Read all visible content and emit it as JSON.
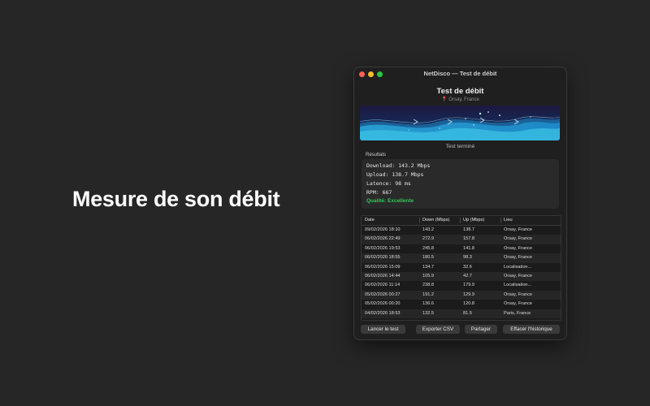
{
  "headline": "Mesure de son débit",
  "window": {
    "title": "NetDisco — Test de débit",
    "heading": "Test de débit",
    "location_pin": "📍",
    "location": "Orsay, France",
    "status": "Test terminé"
  },
  "results": {
    "label": "Résultats",
    "download": "Download: 143.2 Mbps",
    "upload": "Upload: 138.7 Mbps",
    "latency": "Latence: 98 ms",
    "rpm": "RPM: 667",
    "quality": "Qualité: Excellente"
  },
  "table": {
    "headers": [
      "Date",
      "Down (Mbps)",
      "Up (Mbps)",
      "Lieu"
    ],
    "rows": [
      [
        "09/02/2026 18:10",
        "143.2",
        "138.7",
        "Orsay, France"
      ],
      [
        "06/02/2026 22:49",
        "272.9",
        "157.8",
        "Orsay, France"
      ],
      [
        "06/02/2026 19:53",
        "245.8",
        "141.8",
        "Orsay, France"
      ],
      [
        "06/02/2026 18:55",
        "180.5",
        "98.3",
        "Orsay, France"
      ],
      [
        "06/02/2026 15:09",
        "134.7",
        "32.6",
        "Localisation..."
      ],
      [
        "06/02/2026 14:44",
        "105.9",
        "42.7",
        "Orsay, France"
      ],
      [
        "06/02/2026 11:14",
        "238.8",
        "179.9",
        "Localisation..."
      ],
      [
        "05/02/2026 00:27",
        "191.2",
        "129.9",
        "Orsay, France"
      ],
      [
        "05/02/2026 00:20",
        "136.6",
        "120.8",
        "Orsay, France"
      ],
      [
        "04/02/2026 18:53",
        "132.5",
        "81.5",
        "Paris, France"
      ]
    ]
  },
  "buttons": {
    "run": "Lancer le test",
    "export": "Exporter CSV",
    "share": "Partager",
    "clear": "Effacer l'historique"
  },
  "colors": {
    "quality_good": "#34c759",
    "background": "#262626",
    "window": "#1f1f1f"
  }
}
